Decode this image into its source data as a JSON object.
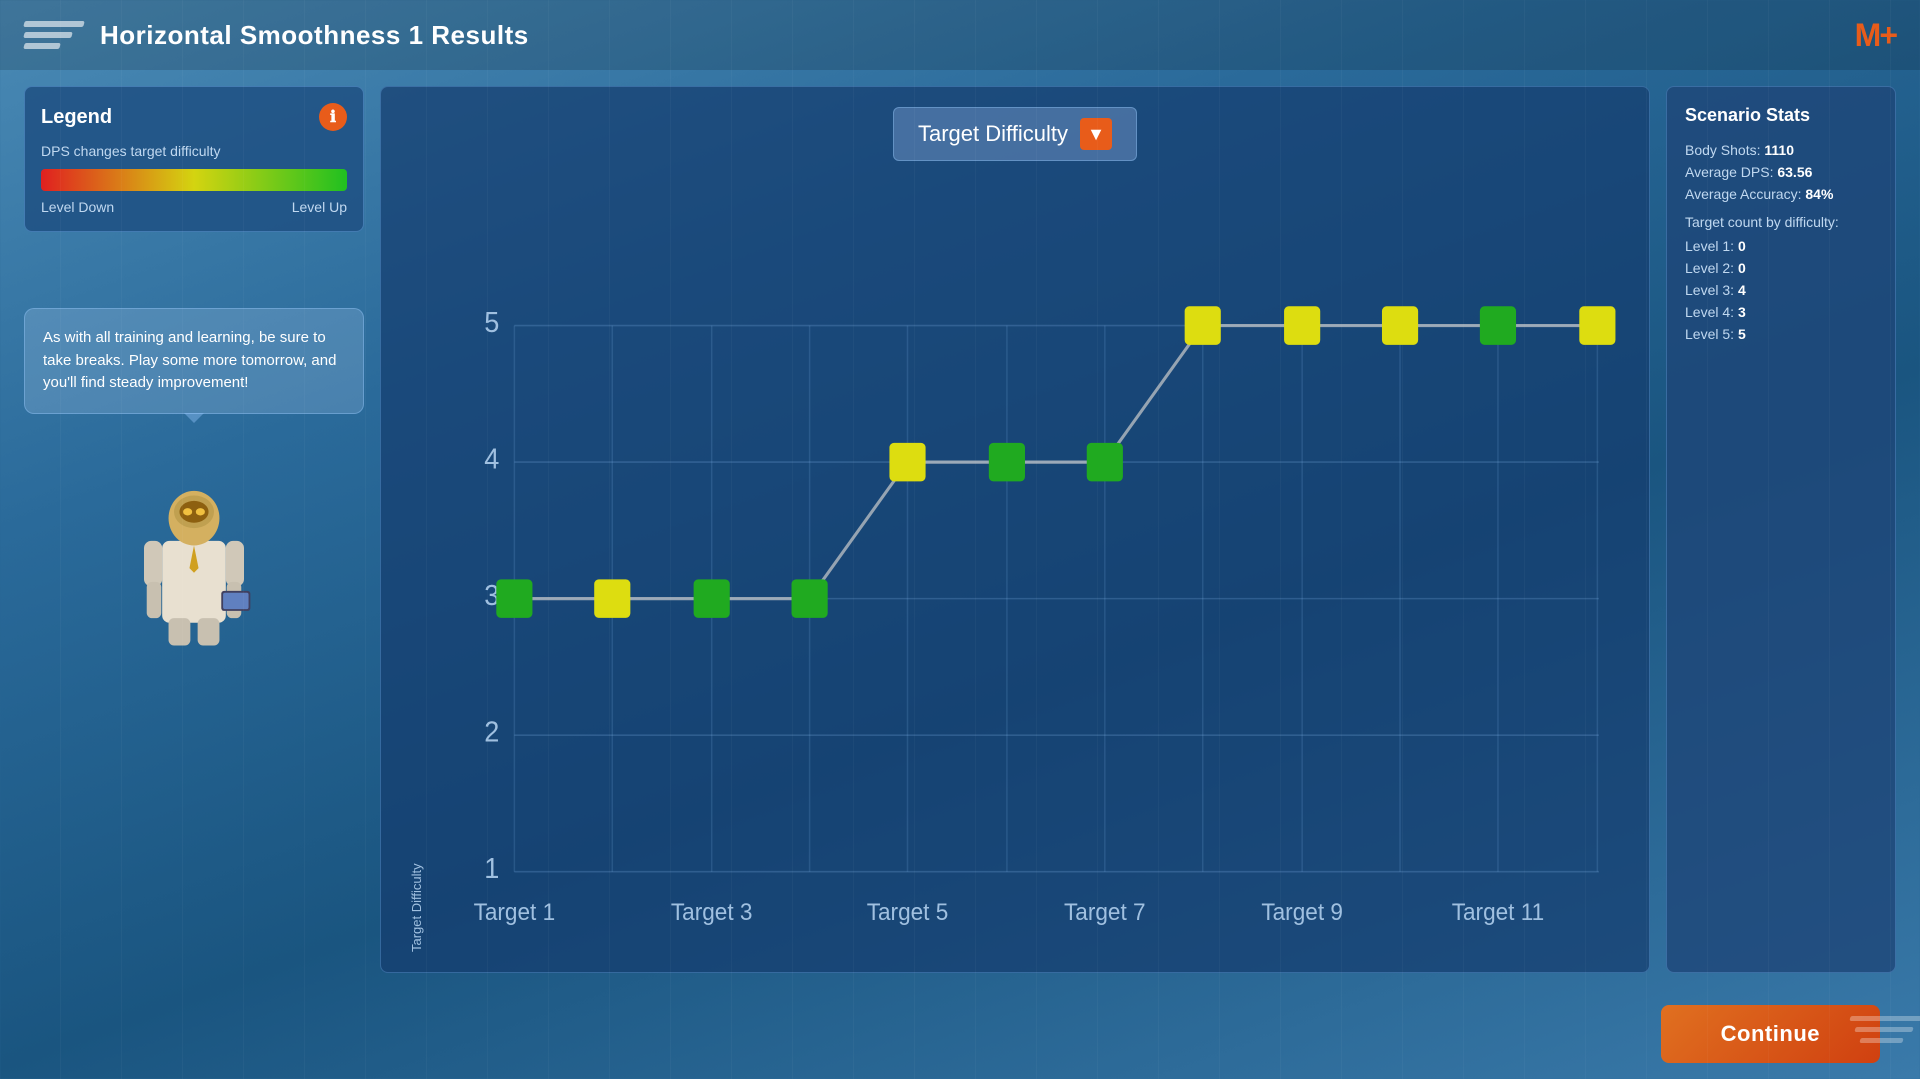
{
  "header": {
    "title": "Horizontal Smoothness 1 Results",
    "logo": "M+"
  },
  "legend": {
    "title": "Legend",
    "description": "DPS changes target difficulty",
    "label_left": "Level Down",
    "label_right": "Level Up",
    "info_icon": "ℹ"
  },
  "speech": {
    "text": "As with all training and learning, be sure to take breaks. Play some more tomorrow, and you'll find steady improvement!"
  },
  "chart": {
    "title": "Target Difficulty",
    "dropdown_label": "▼",
    "y_axis_label": "Target Difficulty",
    "y_ticks": [
      "1",
      "2",
      "3",
      "4",
      "5"
    ],
    "x_labels": [
      "Target 1",
      "Target 3",
      "Target 5",
      "Target 7",
      "Target 9",
      "Target 11"
    ],
    "data_points": [
      {
        "x": 1,
        "y": 3,
        "color": "green"
      },
      {
        "x": 2,
        "y": 3,
        "color": "yellow"
      },
      {
        "x": 3,
        "y": 3,
        "color": "green"
      },
      {
        "x": 4,
        "y": 3,
        "color": "green"
      },
      {
        "x": 5,
        "y": 4,
        "color": "yellow"
      },
      {
        "x": 6,
        "y": 4,
        "color": "green"
      },
      {
        "x": 7,
        "y": 4,
        "color": "green"
      },
      {
        "x": 8,
        "y": 5,
        "color": "yellow"
      },
      {
        "x": 9,
        "y": 5,
        "color": "yellow"
      },
      {
        "x": 10,
        "y": 5,
        "color": "yellow"
      },
      {
        "x": 11,
        "y": 5,
        "color": "green"
      },
      {
        "x": 12,
        "y": 5,
        "color": "yellow"
      }
    ]
  },
  "stats": {
    "title": "Scenario Stats",
    "body_shots_label": "Body Shots:",
    "body_shots_value": "1110",
    "avg_dps_label": "Average DPS:",
    "avg_dps_value": "63.56",
    "avg_accuracy_label": "Average Accuracy:",
    "avg_accuracy_value": "84%",
    "difficulty_label": "Target count by difficulty:",
    "levels": [
      {
        "label": "Level 1:",
        "value": "0"
      },
      {
        "label": "Level 2:",
        "value": "0"
      },
      {
        "label": "Level 3:",
        "value": "4"
      },
      {
        "label": "Level 4:",
        "value": "3"
      },
      {
        "label": "Level 5:",
        "value": "5"
      }
    ]
  },
  "footer": {
    "continue_label": "Continue"
  }
}
